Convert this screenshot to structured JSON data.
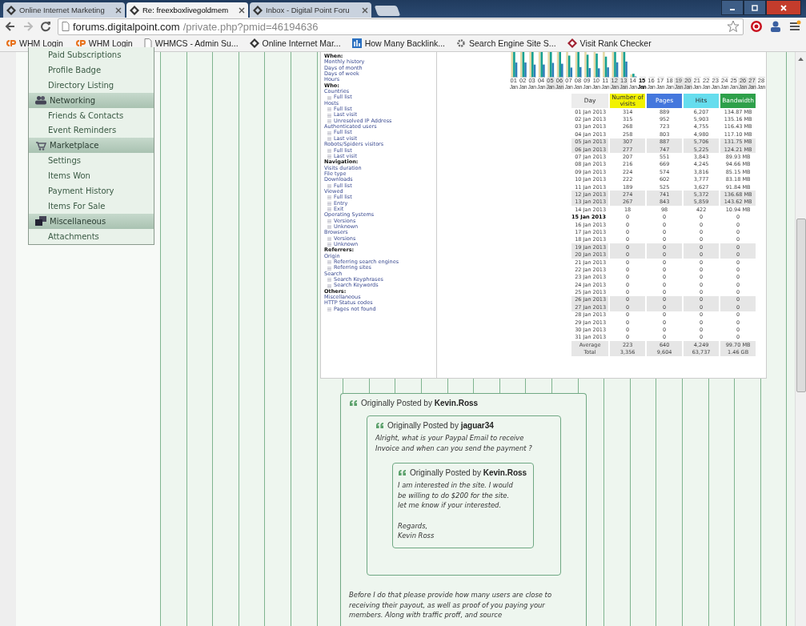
{
  "browser": {
    "tabs": [
      {
        "title": "Online Internet Marketing",
        "selected": false
      },
      {
        "title": "Re: freexboxlivegoldmem",
        "selected": true
      },
      {
        "title": "Inbox - Digital Point Foru",
        "selected": false
      }
    ],
    "url": {
      "host": "forums.digitalpoint.com",
      "path": "/private.php?pmid=46194636"
    },
    "bookmarks": [
      {
        "label": "WHM Login",
        "kind": "cp"
      },
      {
        "label": "WHM Login",
        "kind": "cp"
      },
      {
        "label": "WHMCS - Admin Su...",
        "kind": "page"
      },
      {
        "label": "Online Internet Mar...",
        "kind": "dp"
      },
      {
        "label": "How Many Backlink...",
        "kind": "chart"
      },
      {
        "label": "Search Engine Site S...",
        "kind": "gear"
      },
      {
        "label": "Visit Rank Checker",
        "kind": "diamond"
      }
    ]
  },
  "sidebar": {
    "items": [
      {
        "label": "Paid Subscriptions",
        "kind": "link"
      },
      {
        "label": "Profile Badge",
        "kind": "link"
      },
      {
        "label": "Directory Listing",
        "kind": "link"
      },
      {
        "label": "Networking",
        "kind": "header"
      },
      {
        "label": "Friends & Contacts",
        "kind": "link"
      },
      {
        "label": "Event Reminders",
        "kind": "link"
      },
      {
        "label": "Marketplace",
        "kind": "header"
      },
      {
        "label": "Settings",
        "kind": "link"
      },
      {
        "label": "Items Won",
        "kind": "link"
      },
      {
        "label": "Payment History",
        "kind": "link"
      },
      {
        "label": "Items For Sale",
        "kind": "link"
      },
      {
        "label": "Miscellaneous",
        "kind": "header"
      },
      {
        "label": "Attachments",
        "kind": "link"
      }
    ]
  },
  "stats": {
    "menu": [
      {
        "label": "When:",
        "kind": "heading"
      },
      {
        "label": "Monthly history",
        "kind": "link"
      },
      {
        "label": "Days of month",
        "kind": "link"
      },
      {
        "label": "Days of week",
        "kind": "link"
      },
      {
        "label": "Hours",
        "kind": "link"
      },
      {
        "label": "Who:",
        "kind": "heading"
      },
      {
        "label": "Countries",
        "kind": "link"
      },
      {
        "label": "Full list",
        "kind": "sub"
      },
      {
        "label": "Hosts",
        "kind": "link"
      },
      {
        "label": "Full list",
        "kind": "sub"
      },
      {
        "label": "Last visit",
        "kind": "sub"
      },
      {
        "label": "Unresolved IP Address",
        "kind": "sub"
      },
      {
        "label": "Authenticated users",
        "kind": "link"
      },
      {
        "label": "Full list",
        "kind": "sub"
      },
      {
        "label": "Last visit",
        "kind": "sub"
      },
      {
        "label": "Robots/Spiders visitors",
        "kind": "link"
      },
      {
        "label": "Full list",
        "kind": "sub"
      },
      {
        "label": "Last visit",
        "kind": "sub"
      },
      {
        "label": "Navigation:",
        "kind": "heading"
      },
      {
        "label": "Visits duration",
        "kind": "link"
      },
      {
        "label": "File type",
        "kind": "link"
      },
      {
        "label": "Downloads",
        "kind": "link"
      },
      {
        "label": "Full list",
        "kind": "sub"
      },
      {
        "label": "Viewed",
        "kind": "link"
      },
      {
        "label": "Full list",
        "kind": "sub"
      },
      {
        "label": "Entry",
        "kind": "sub"
      },
      {
        "label": "Exit",
        "kind": "sub"
      },
      {
        "label": "Operating Systems",
        "kind": "link"
      },
      {
        "label": "Versions",
        "kind": "sub"
      },
      {
        "label": "Unknown",
        "kind": "sub"
      },
      {
        "label": "Browsers",
        "kind": "link"
      },
      {
        "label": "Versions",
        "kind": "sub"
      },
      {
        "label": "Unknown",
        "kind": "sub"
      },
      {
        "label": "Referrers:",
        "kind": "heading"
      },
      {
        "label": "Origin",
        "kind": "link"
      },
      {
        "label": "Referring search engines",
        "kind": "sub"
      },
      {
        "label": "Referring sites",
        "kind": "sub"
      },
      {
        "label": "Search",
        "kind": "link"
      },
      {
        "label": "Search Keyphrases",
        "kind": "sub"
      },
      {
        "label": "Search Keywords",
        "kind": "sub"
      },
      {
        "label": "Others:",
        "kind": "heading"
      },
      {
        "label": "Miscellaneous",
        "kind": "link"
      },
      {
        "label": "HTTP Status codes",
        "kind": "link"
      },
      {
        "label": "Pages not found",
        "kind": "sub"
      }
    ],
    "chart_labels": [
      {
        "day": "01",
        "month": "Jan",
        "weekend": false,
        "today": false
      },
      {
        "day": "02",
        "month": "Jan",
        "weekend": false,
        "today": false
      },
      {
        "day": "03",
        "month": "Jan",
        "weekend": false,
        "today": false
      },
      {
        "day": "04",
        "month": "Jan",
        "weekend": false,
        "today": false
      },
      {
        "day": "05",
        "month": "Jan",
        "weekend": true,
        "today": false
      },
      {
        "day": "06",
        "month": "Jan",
        "weekend": true,
        "today": false
      },
      {
        "day": "07",
        "month": "Jan",
        "weekend": false,
        "today": false
      },
      {
        "day": "08",
        "month": "Jan",
        "weekend": false,
        "today": false
      },
      {
        "day": "09",
        "month": "Jan",
        "weekend": false,
        "today": false
      },
      {
        "day": "10",
        "month": "Jan",
        "weekend": false,
        "today": false
      },
      {
        "day": "11",
        "month": "Jan",
        "weekend": false,
        "today": false
      },
      {
        "day": "12",
        "month": "Jan",
        "weekend": true,
        "today": false
      },
      {
        "day": "13",
        "month": "Jan",
        "weekend": true,
        "today": false
      },
      {
        "day": "14",
        "month": "Jan",
        "weekend": false,
        "today": false
      },
      {
        "day": "15",
        "month": "Jan",
        "weekend": false,
        "today": true
      },
      {
        "day": "16",
        "month": "Jan",
        "weekend": false,
        "today": false
      },
      {
        "day": "17",
        "month": "Jan",
        "weekend": false,
        "today": false
      },
      {
        "day": "18",
        "month": "Jan",
        "weekend": false,
        "today": false
      },
      {
        "day": "19",
        "month": "Jan",
        "weekend": true,
        "today": false
      },
      {
        "day": "20",
        "month": "Jan",
        "weekend": true,
        "today": false
      },
      {
        "day": "21",
        "month": "Jan",
        "weekend": false,
        "today": false
      },
      {
        "day": "22",
        "month": "Jan",
        "weekend": false,
        "today": false
      },
      {
        "day": "23",
        "month": "Jan",
        "weekend": false,
        "today": false
      },
      {
        "day": "24",
        "month": "Jan",
        "weekend": false,
        "today": false
      },
      {
        "day": "25",
        "month": "Jan",
        "weekend": false,
        "today": false
      },
      {
        "day": "26",
        "month": "Jan",
        "weekend": true,
        "today": false
      },
      {
        "day": "27",
        "month": "Jan",
        "weekend": true,
        "today": false
      },
      {
        "day": "28",
        "month": "Jan",
        "weekend": false,
        "today": false
      }
    ],
    "table": {
      "columns": [
        {
          "label": "Day",
          "color": "#ececec"
        },
        {
          "label": "Number of visits",
          "color": "#f2f200"
        },
        {
          "label": "Pages",
          "color": "#4477dd"
        },
        {
          "label": "Hits",
          "color": "#66ddee"
        },
        {
          "label": "Bandwidth",
          "color": "#2ea04a"
        }
      ],
      "rows": [
        {
          "cells": [
            "01 Jan 2013",
            "314",
            "889",
            "6,207",
            "134.87 MB"
          ],
          "weekend": false,
          "today": false
        },
        {
          "cells": [
            "02 Jan 2013",
            "315",
            "952",
            "5,903",
            "135.16 MB"
          ],
          "weekend": false,
          "today": false
        },
        {
          "cells": [
            "03 Jan 2013",
            "268",
            "723",
            "4,755",
            "116.43 MB"
          ],
          "weekend": false,
          "today": false
        },
        {
          "cells": [
            "04 Jan 2013",
            "258",
            "803",
            "4,980",
            "117.10 MB"
          ],
          "weekend": false,
          "today": false
        },
        {
          "cells": [
            "05 Jan 2013",
            "307",
            "887",
            "5,706",
            "131.75 MB"
          ],
          "weekend": true,
          "today": false
        },
        {
          "cells": [
            "06 Jan 2013",
            "277",
            "747",
            "5,225",
            "124.21 MB"
          ],
          "weekend": true,
          "today": false
        },
        {
          "cells": [
            "07 Jan 2013",
            "207",
            "551",
            "3,843",
            "89.93 MB"
          ],
          "weekend": false,
          "today": false
        },
        {
          "cells": [
            "08 Jan 2013",
            "216",
            "669",
            "4,245",
            "94.66 MB"
          ],
          "weekend": false,
          "today": false
        },
        {
          "cells": [
            "09 Jan 2013",
            "224",
            "574",
            "3,816",
            "85.15 MB"
          ],
          "weekend": false,
          "today": false
        },
        {
          "cells": [
            "10 Jan 2013",
            "222",
            "602",
            "3,777",
            "83.18 MB"
          ],
          "weekend": false,
          "today": false
        },
        {
          "cells": [
            "11 Jan 2013",
            "189",
            "525",
            "3,627",
            "91.84 MB"
          ],
          "weekend": false,
          "today": false
        },
        {
          "cells": [
            "12 Jan 2013",
            "274",
            "741",
            "5,372",
            "136.68 MB"
          ],
          "weekend": true,
          "today": false
        },
        {
          "cells": [
            "13 Jan 2013",
            "267",
            "843",
            "5,859",
            "143.62 MB"
          ],
          "weekend": true,
          "today": false
        },
        {
          "cells": [
            "14 Jan 2013",
            "18",
            "98",
            "422",
            "10.94 MB"
          ],
          "weekend": false,
          "today": false
        },
        {
          "cells": [
            "15 Jan 2013",
            "0",
            "0",
            "0",
            "0"
          ],
          "weekend": false,
          "today": true
        },
        {
          "cells": [
            "16 Jan 2013",
            "0",
            "0",
            "0",
            "0"
          ],
          "weekend": false,
          "today": false
        },
        {
          "cells": [
            "17 Jan 2013",
            "0",
            "0",
            "0",
            "0"
          ],
          "weekend": false,
          "today": false
        },
        {
          "cells": [
            "18 Jan 2013",
            "0",
            "0",
            "0",
            "0"
          ],
          "weekend": false,
          "today": false
        },
        {
          "cells": [
            "19 Jan 2013",
            "0",
            "0",
            "0",
            "0"
          ],
          "weekend": true,
          "today": false
        },
        {
          "cells": [
            "20 Jan 2013",
            "0",
            "0",
            "0",
            "0"
          ],
          "weekend": true,
          "today": false
        },
        {
          "cells": [
            "21 Jan 2013",
            "0",
            "0",
            "0",
            "0"
          ],
          "weekend": false,
          "today": false
        },
        {
          "cells": [
            "22 Jan 2013",
            "0",
            "0",
            "0",
            "0"
          ],
          "weekend": false,
          "today": false
        },
        {
          "cells": [
            "23 Jan 2013",
            "0",
            "0",
            "0",
            "0"
          ],
          "weekend": false,
          "today": false
        },
        {
          "cells": [
            "24 Jan 2013",
            "0",
            "0",
            "0",
            "0"
          ],
          "weekend": false,
          "today": false
        },
        {
          "cells": [
            "25 Jan 2013",
            "0",
            "0",
            "0",
            "0"
          ],
          "weekend": false,
          "today": false
        },
        {
          "cells": [
            "26 Jan 2013",
            "0",
            "0",
            "0",
            "0"
          ],
          "weekend": true,
          "today": false
        },
        {
          "cells": [
            "27 Jan 2013",
            "0",
            "0",
            "0",
            "0"
          ],
          "weekend": true,
          "today": false
        },
        {
          "cells": [
            "28 Jan 2013",
            "0",
            "0",
            "0",
            "0"
          ],
          "weekend": false,
          "today": false
        },
        {
          "cells": [
            "29 Jan 2013",
            "0",
            "0",
            "0",
            "0"
          ],
          "weekend": false,
          "today": false
        },
        {
          "cells": [
            "30 Jan 2013",
            "0",
            "0",
            "0",
            "0"
          ],
          "weekend": false,
          "today": false
        },
        {
          "cells": [
            "31 Jan 2013",
            "0",
            "0",
            "0",
            "0"
          ],
          "weekend": false,
          "today": false
        }
      ],
      "footer": [
        {
          "cells": [
            "Average",
            "223",
            "640",
            "4,249",
            "99.70 MB"
          ]
        },
        {
          "cells": [
            "Total",
            "3,356",
            "9,604",
            "63,737",
            "1.46 GB"
          ]
        }
      ]
    }
  },
  "quote": {
    "label": "Originally Posted by",
    "author": "Kevin.Ross",
    "body": [
      {
        "kind": "quote",
        "label": "Originally Posted by",
        "author": "jaguar34",
        "body": [
          {
            "kind": "text",
            "text": "Alright, what is your Paypal Email to receive\nInvoice and when can you send the payment ?"
          },
          {
            "kind": "quote",
            "label": "Originally Posted by",
            "author": "Kevin.Ross",
            "body": [
              {
                "kind": "text",
                "text": "I am interested in the site. I would\nbe willing to do $200 for the site.\nlet me know if your interested.\n\nRegards,\nKevin Ross"
              }
            ]
          }
        ]
      },
      {
        "kind": "text",
        "text": "Before I do that please provide how many users are close to\nreceiving their payout, as well as proof of you paying your\nmembers. Along with traffic proff, and source"
      }
    ]
  }
}
